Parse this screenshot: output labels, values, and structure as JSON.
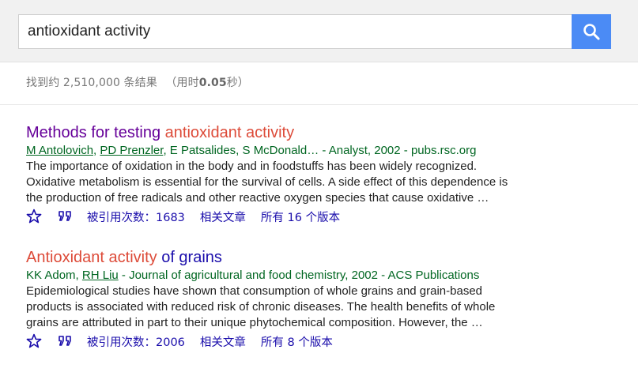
{
  "search": {
    "query": "antioxidant activity",
    "button_icon": "search-icon"
  },
  "stats": {
    "prefix": "找到约 2,510,000 条结果",
    "time_open": "（用时",
    "time_value": "0.05",
    "time_close": "秒）"
  },
  "results": [
    {
      "title_part1": "Methods for testing ",
      "title_part2": "antioxidant activity",
      "authors": [
        {
          "name": "M Antolovich",
          "linked": true
        },
        {
          "name": "PD Prenzler",
          "linked": true
        },
        {
          "name": "E Patsalides",
          "linked": false
        },
        {
          "name": "S McDonald…",
          "linked": false
        }
      ],
      "source": " - Analyst, 2002 - pubs.rsc.org",
      "snippet": [
        "The importance of oxidation in the body and in foodstuffs has been widely recognized.",
        "Oxidative metabolism is essential for the survival of cells. A side effect of this dependence is",
        "the production of free radicals and other reactive oxygen species that cause oxidative …"
      ],
      "star_icon": "star-icon",
      "cite_icon": "quote-icon",
      "cited_label": "被引用次数：",
      "cited_count": "1683",
      "related_label": "相关文章",
      "versions_label": "所有 16 个版本"
    },
    {
      "title_part1": "Antioxidant activity",
      "title_part2": " of grains",
      "authors": [
        {
          "name": "KK Adom",
          "linked": false
        },
        {
          "name": "RH Liu",
          "linked": true
        }
      ],
      "source": " - Journal of agricultural and food chemistry, 2002 - ACS Publications",
      "snippet": [
        "Epidemiological studies have shown that consumption of whole grains and grain-based",
        "products is associated with reduced risk of chronic diseases. The health benefits of whole",
        "grains are attributed in part to their unique phytochemical composition. However, the …"
      ],
      "star_icon": "star-icon",
      "cite_icon": "quote-icon",
      "cited_label": "被引用次数：",
      "cited_count": "2006",
      "related_label": "相关文章",
      "versions_label": "所有 8 个版本"
    }
  ],
  "colors": {
    "visited_title": "#660099",
    "link": "#1a0dab",
    "highlight": "#dd4b39",
    "meta_green": "#006621",
    "search_button": "#4b8bf5"
  }
}
